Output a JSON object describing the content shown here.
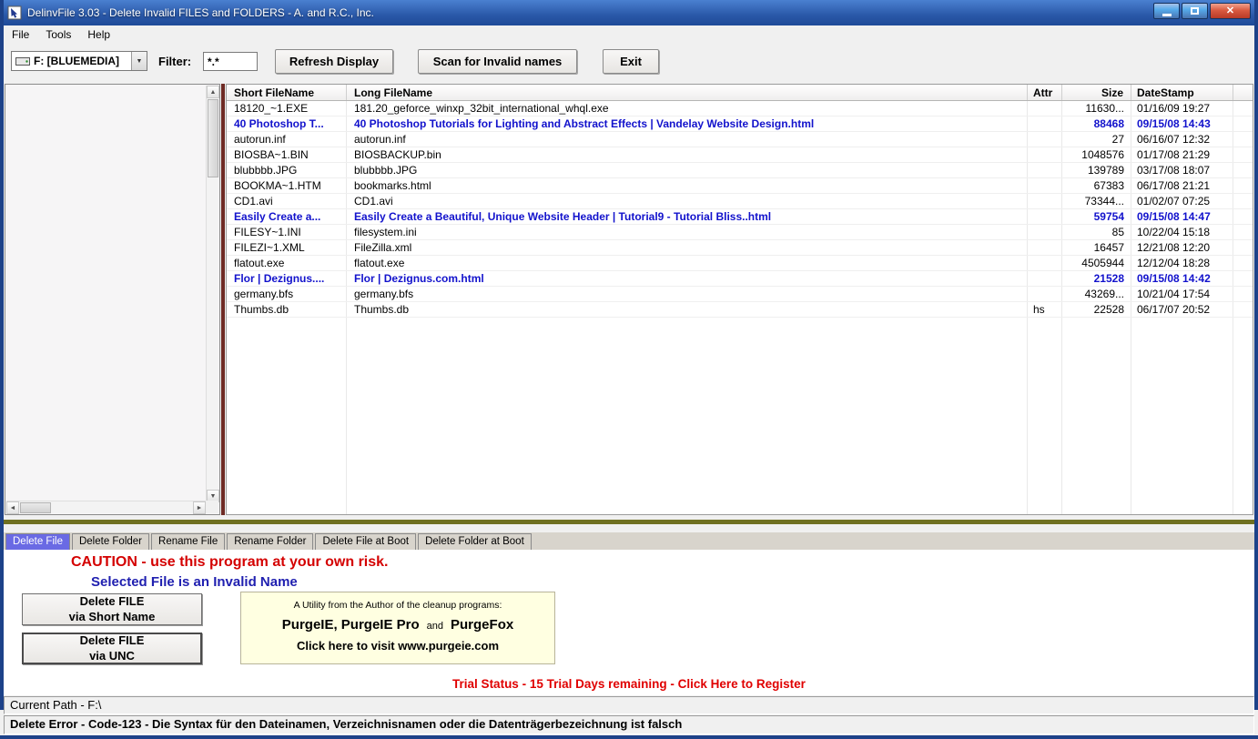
{
  "window": {
    "title": "DelinvFile 3.03 - Delete Invalid FILES and FOLDERS - A. and R.C., Inc."
  },
  "menu": {
    "items": [
      "File",
      "Tools",
      "Help"
    ]
  },
  "toolbar": {
    "drive_selector": {
      "value": "F: [BLUEMEDIA]"
    },
    "filter_label": "Filter:",
    "filter_value": "*.*",
    "refresh_button": "Refresh Display",
    "scan_button": "Scan for Invalid names",
    "exit_button": "Exit"
  },
  "file_table": {
    "columns": [
      "Short FileName",
      "Long FileName",
      "Attr",
      "Size",
      "DateStamp"
    ],
    "rows": [
      {
        "short": "18120_~1.EXE",
        "long": "181.20_geforce_winxp_32bit_international_whql.exe",
        "attr": "",
        "size": "11630...",
        "date": "01/16/09 19:27",
        "invalid": false
      },
      {
        "short": "40 Photoshop T...",
        "long": "40 Photoshop Tutorials for Lighting and Abstract Effects | Vandelay Website Design.html",
        "attr": "",
        "size": "88468",
        "date": "09/15/08 14:43",
        "invalid": true
      },
      {
        "short": "autorun.inf",
        "long": "autorun.inf",
        "attr": "",
        "size": "27",
        "date": "06/16/07 12:32",
        "invalid": false
      },
      {
        "short": "BIOSBA~1.BIN",
        "long": "BIOSBACKUP.bin",
        "attr": "",
        "size": "1048576",
        "date": "01/17/08 21:29",
        "invalid": false
      },
      {
        "short": "blubbbb.JPG",
        "long": "blubbbb.JPG",
        "attr": "",
        "size": "139789",
        "date": "03/17/08 18:07",
        "invalid": false
      },
      {
        "short": "BOOKMA~1.HTM",
        "long": "bookmarks.html",
        "attr": "",
        "size": "67383",
        "date": "06/17/08 21:21",
        "invalid": false
      },
      {
        "short": "CD1.avi",
        "long": "CD1.avi",
        "attr": "",
        "size": "73344...",
        "date": "01/02/07 07:25",
        "invalid": false
      },
      {
        "short": "Easily Create a...",
        "long": "Easily Create a Beautiful, Unique Website Header | Tutorial9 - Tutorial Bliss..html",
        "attr": "",
        "size": "59754",
        "date": "09/15/08 14:47",
        "invalid": true
      },
      {
        "short": "FILESY~1.INI",
        "long": "filesystem.ini",
        "attr": "",
        "size": "85",
        "date": "10/22/04 15:18",
        "invalid": false
      },
      {
        "short": "FILEZI~1.XML",
        "long": "FileZilla.xml",
        "attr": "",
        "size": "16457",
        "date": "12/21/08 12:20",
        "invalid": false
      },
      {
        "short": "flatout.exe",
        "long": "flatout.exe",
        "attr": "",
        "size": "4505944",
        "date": "12/12/04 18:28",
        "invalid": false
      },
      {
        "short": "Flor | Dezignus....",
        "long": "Flor | Dezignus.com.html",
        "attr": "",
        "size": "21528",
        "date": "09/15/08 14:42",
        "invalid": true
      },
      {
        "short": "germany.bfs",
        "long": "germany.bfs",
        "attr": "",
        "size": "43269...",
        "date": "10/21/04 17:54",
        "invalid": false
      },
      {
        "short": "Thumbs.db",
        "long": "Thumbs.db",
        "attr": "hs",
        "size": "22528",
        "date": "06/17/07 20:52",
        "invalid": false
      }
    ]
  },
  "tabs": {
    "labels": [
      "Delete File",
      "Delete Folder",
      "Rename File",
      "Rename Folder",
      "Delete File at Boot",
      "Delete Folder at Boot"
    ],
    "active_index": 0
  },
  "panel": {
    "caution_text": "CAUTION - use this program at your own risk.",
    "selected_text": "Selected File is an Invalid Name",
    "buttons": [
      {
        "line1": "Delete FILE",
        "line2": "via Short Name"
      },
      {
        "line1": "Delete FILE",
        "line2": "via UNC"
      }
    ],
    "promo": {
      "heading": "A Utility from the Author of the cleanup programs:",
      "products_1": "PurgeIE, PurgeIE Pro",
      "and_word": "and",
      "products_2": "PurgeFox",
      "link_line": "Click here to visit  www.purgeie.com"
    },
    "trial_text": "Trial Status  -  15 Trial Days remaining - Click Here to Register"
  },
  "status": {
    "current_path": "Current Path - F:\\",
    "error_text": "Delete Error - Code-123 - Die Syntax für den Dateinamen, Verzeichnisnamen oder die Datenträgerbezeichnung ist falsch"
  },
  "colors": {
    "invalid_blue": "#1212cc",
    "caution_red": "#d40000",
    "trial_red": "#e00000",
    "selected_navy": "#2020b0",
    "splitter_maroon": "#6e2a24",
    "divider_olive": "#6f7021",
    "active_tab_blue": "#6a6ae4",
    "titlebar_blue": "#2a58a8"
  }
}
